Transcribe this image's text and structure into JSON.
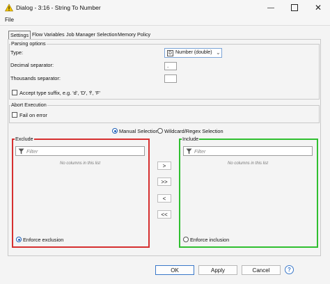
{
  "window": {
    "title": "Dialog - 3:16 - String To Number",
    "minimize_icon": "minimize-icon",
    "maximize_icon": "maximize-icon",
    "close_icon": "close-icon"
  },
  "menu": {
    "file_label": "File"
  },
  "tabs": [
    {
      "label": "Settings"
    },
    {
      "label": "Flow Variables"
    },
    {
      "label": "Job Manager Selection"
    },
    {
      "label": "Memory Policy"
    }
  ],
  "parsing": {
    "legend": "Parsing options",
    "type_label": "Type:",
    "type_value": "Number (double)",
    "type_badge": "D",
    "decimal_label": "Decimal separator:",
    "decimal_value": ".",
    "thousands_label": "Thousands separator:",
    "thousands_value": "",
    "accept_suffix_label": "Accept type suffix, e.g. 'd', 'D', 'f', 'F'"
  },
  "abort": {
    "legend": "Abort Execution",
    "fail_label": "Fail on error"
  },
  "selection_mode": {
    "manual_label": "Manual Selection",
    "wildcard_label": "Wildcard/Regex Selection",
    "selected": "manual"
  },
  "exclude": {
    "legend": "Exclude",
    "filter_placeholder": "Filter",
    "empty_text": "No columns in this list",
    "enforce_label": "Enforce exclusion",
    "border_color": "#d62f2f"
  },
  "include": {
    "legend": "Include",
    "filter_placeholder": "Filter",
    "empty_text": "No columns in this list",
    "enforce_label": "Enforce inclusion",
    "border_color": "#2fbf2f"
  },
  "move_buttons": [
    {
      "label": ">"
    },
    {
      "label": ">>"
    },
    {
      "label": "<"
    },
    {
      "label": "<<"
    }
  ],
  "footer": {
    "ok_label": "OK",
    "apply_label": "Apply",
    "cancel_label": "Cancel",
    "help_icon": "help-icon"
  }
}
